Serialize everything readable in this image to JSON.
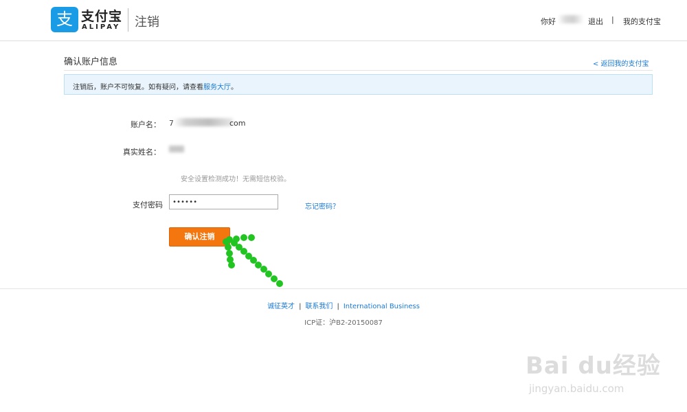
{
  "header": {
    "logo_glyph": "支",
    "brand_cn": "支付宝",
    "brand_en": "ALIPAY",
    "section": "注销",
    "greeting": "你好",
    "logout": "退出",
    "separator": "|",
    "my_alipay": "我的支付宝"
  },
  "main": {
    "title": "确认账户信息",
    "back_link": "< 返回我的支付宝",
    "notice": {
      "text": "注销后，账户不可恢复。如有疑问，请查看",
      "link": "服务大厅",
      "suffix": "。"
    },
    "account_label": "账户名：",
    "account_value_prefix": "7",
    "account_value_suffix": "com",
    "realname_label": "真实姓名：",
    "security_ok": "安全设置检测成功！无需短信校验。",
    "password_label": "支付密码",
    "password_value": "••••••",
    "forgot_password": "忘记密码？",
    "confirm_button": "确认注销"
  },
  "footer": {
    "links": [
      "诚征英才",
      "联系我们",
      "International Business"
    ],
    "icp": "ICP证：沪B2-20150087"
  },
  "watermark": {
    "brand": "Bai du经验",
    "url": "jingyan.baidu.com"
  },
  "colors": {
    "brand_blue": "#1a9be6",
    "link_blue": "#1a7ad6",
    "confirm_orange": "#f3760e",
    "annotation_green": "#22c422"
  }
}
